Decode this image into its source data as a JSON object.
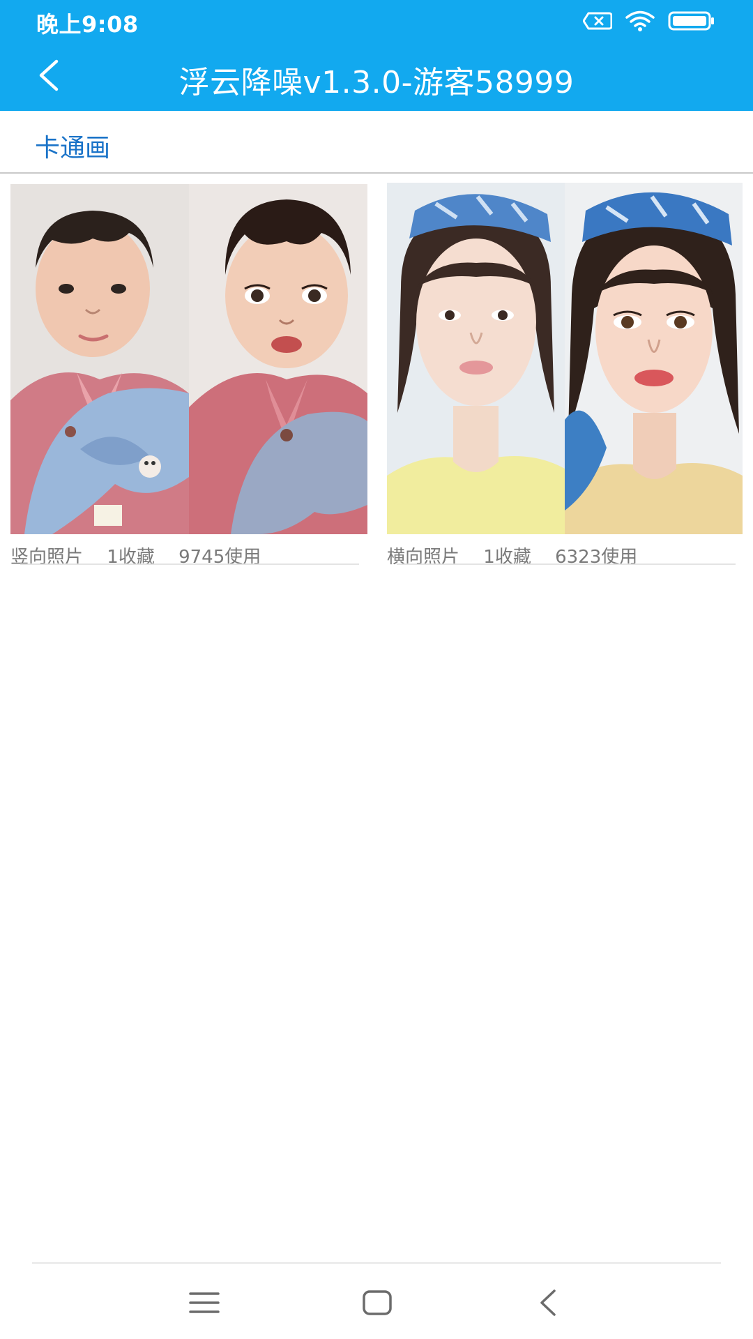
{
  "status_bar": {
    "time": "晚上9:08",
    "icons": [
      "sim-error-icon",
      "wifi-icon",
      "battery-icon"
    ]
  },
  "app_bar": {
    "back_icon": "chevron-left-icon",
    "title": "浮云降噪v1.3.0-游客58999",
    "background": "#12a9ef"
  },
  "category": {
    "label": "卡通画",
    "color": "#1a73c8"
  },
  "cards": [
    {
      "image": "baby-photo-vs-cartoon-portrait",
      "type": "竖向照片",
      "favorites": "1收藏",
      "uses": "9745使用"
    },
    {
      "image": "woman-photo-vs-cartoon-portrait",
      "type": "横向照片",
      "favorites": "1收藏",
      "uses": "6323使用"
    }
  ],
  "nav_bar": {
    "icons": [
      "menu-icon",
      "home-icon",
      "back-icon"
    ]
  }
}
